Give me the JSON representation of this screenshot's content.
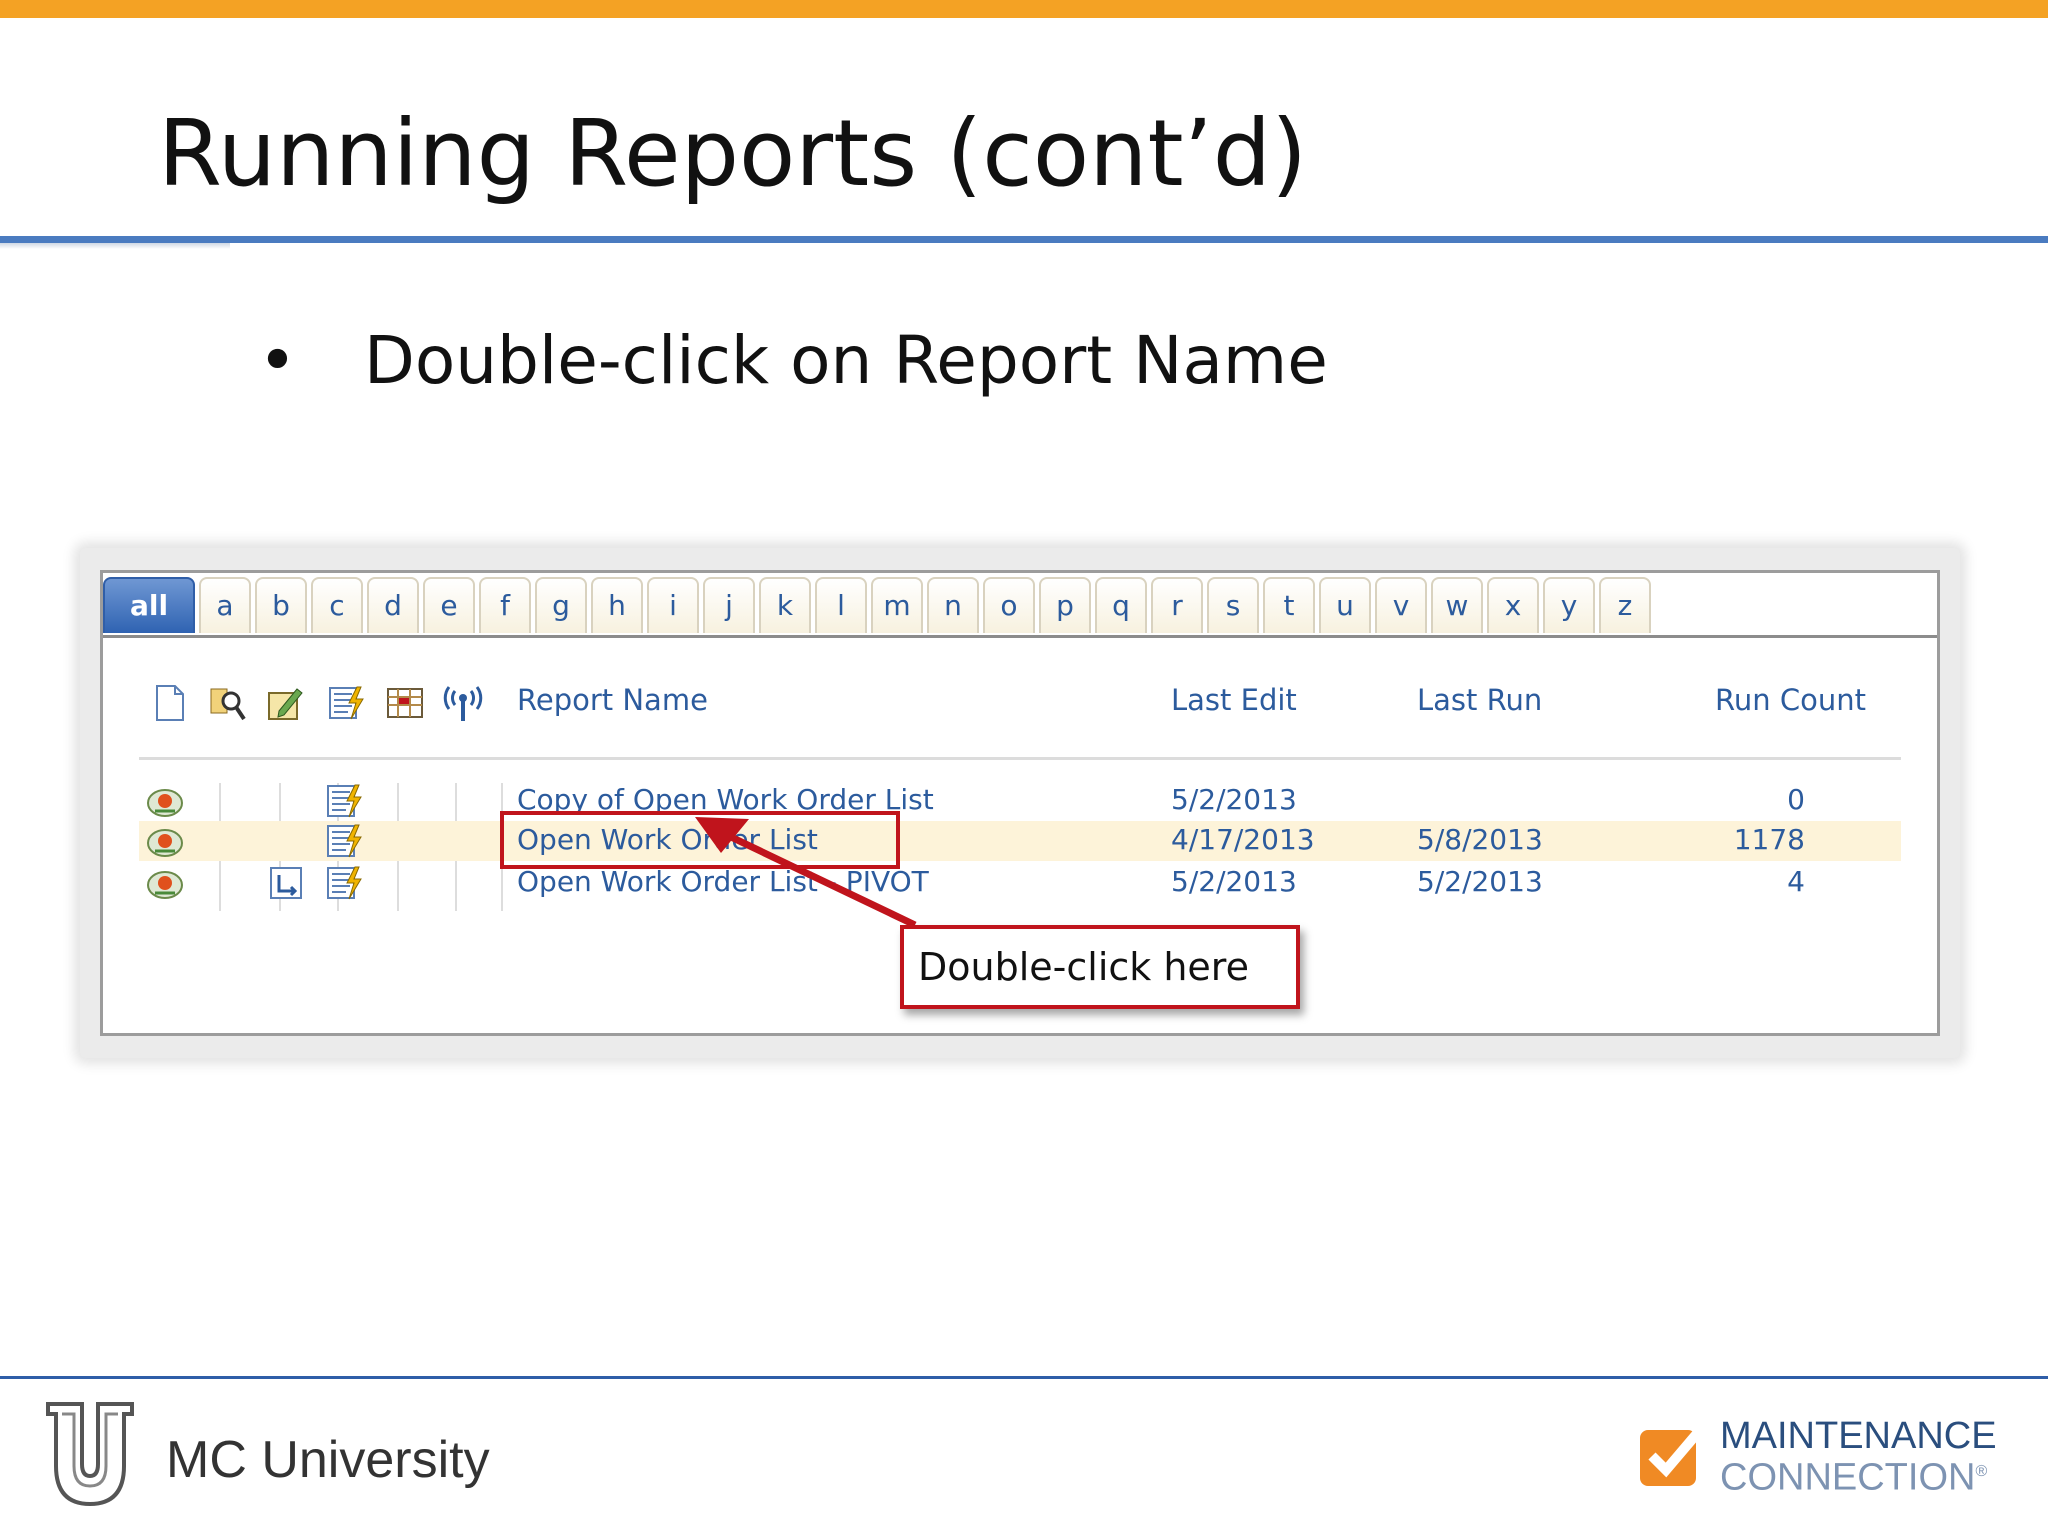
{
  "slide": {
    "title": "Running Reports (cont’d)",
    "bullet_mark": "•",
    "bullet_text": "Double-click on Report Name"
  },
  "tabs": [
    "all",
    "a",
    "b",
    "c",
    "d",
    "e",
    "f",
    "g",
    "h",
    "i",
    "j",
    "k",
    "l",
    "m",
    "n",
    "o",
    "p",
    "q",
    "r",
    "s",
    "t",
    "u",
    "v",
    "w",
    "x",
    "y",
    "z"
  ],
  "active_tab": "all",
  "columns": {
    "report_name": "Report Name",
    "last_edit": "Last Edit",
    "last_run": "Last Run",
    "run_count": "Run Count"
  },
  "reports": [
    {
      "name": "Copy of Open Work Order List",
      "last_edit": "5/2/2013",
      "last_run": "",
      "run_count": "0"
    },
    {
      "name": "Open Work Order List",
      "last_edit": "4/17/2013",
      "last_run": "5/8/2013",
      "run_count": "1178"
    },
    {
      "name": "Open Work Order List - PIVOT",
      "last_edit": "5/2/2013",
      "last_run": "5/2/2013",
      "run_count": "4"
    }
  ],
  "callout": {
    "text": "Double-click here"
  },
  "footer": {
    "university_label": "MC University",
    "brand_line1": "MAINTENANCE",
    "brand_line2": "CONNECTION",
    "brand_mark": "®"
  },
  "colors": {
    "top_bar": "#f4a224",
    "title_rule": "#4a7bc0",
    "link": "#2c5b9d",
    "highlight_row": "#fdf3d9",
    "callout_red": "#c0141c"
  }
}
